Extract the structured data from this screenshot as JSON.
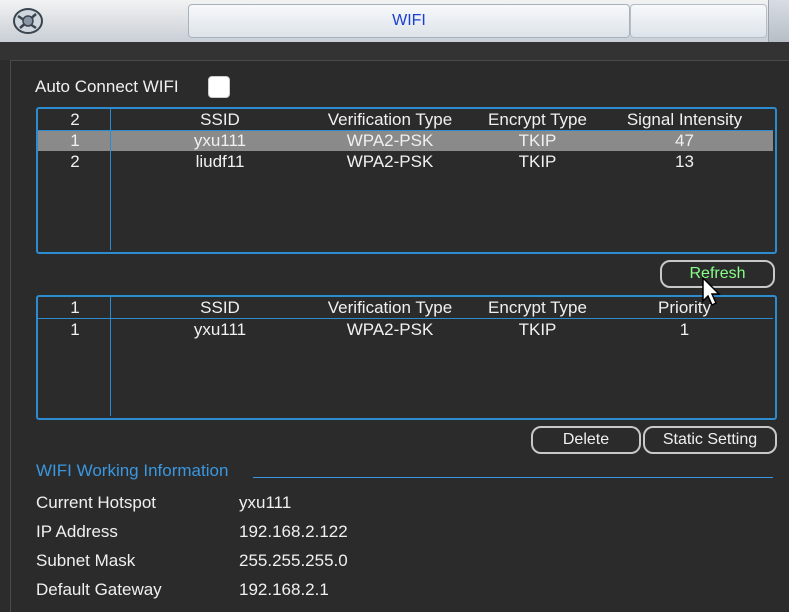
{
  "window": {
    "title": "WIFI"
  },
  "auto_connect": {
    "label": "Auto Connect WIFI",
    "checked": false
  },
  "available_networks": {
    "headers": [
      "2",
      "SSID",
      "Verification Type",
      "Encrypt Type",
      "Signal Intensity"
    ],
    "rows": [
      [
        "1",
        "yxu111",
        "WPA2-PSK",
        "TKIP",
        "47"
      ],
      [
        "2",
        "liudf11",
        "WPA2-PSK",
        "TKIP",
        "13"
      ]
    ],
    "selected_row": 0
  },
  "buttons": {
    "refresh": "Refresh",
    "delete": "Delete",
    "static_setting": "Static Setting"
  },
  "saved_networks": {
    "headers": [
      "1",
      "SSID",
      "Verification Type",
      "Encrypt Type",
      "Priority"
    ],
    "rows": [
      [
        "1",
        "yxu111",
        "WPA2-PSK",
        "TKIP",
        "1"
      ]
    ]
  },
  "working_info": {
    "title": "WIFI Working Information",
    "items": [
      {
        "label": "Current Hotspot",
        "value": "yxu111"
      },
      {
        "label": "IP Address",
        "value": "192.168.2.122"
      },
      {
        "label": "Subnet Mask",
        "value": "255.255.255.0"
      },
      {
        "label": "Default Gateway",
        "value": "192.168.2.1"
      }
    ]
  },
  "colors": {
    "accent": "#2d8bd0",
    "title_text": "#1a40d0",
    "refresh_text": "#88ff88",
    "selected_row": "#8a8a8a"
  }
}
